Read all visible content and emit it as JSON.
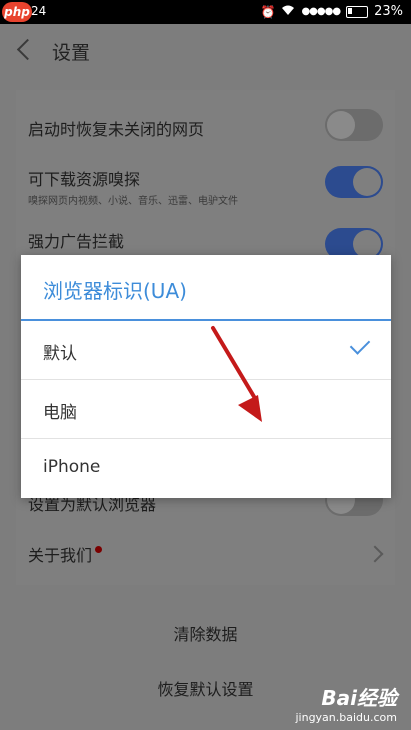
{
  "status_bar": {
    "logo": "php",
    "time": "24",
    "battery": "23%"
  },
  "header": {
    "title": "设置"
  },
  "settings": [
    {
      "title": "启动时恢复未关闭的网页",
      "sub": "",
      "toggle": "off"
    },
    {
      "title": "可下载资源嗅探",
      "sub": "嗅探网页内视频、小说、音乐、迅雷、电驴文件",
      "toggle": "on"
    },
    {
      "title": "强力广告拦截",
      "sub": "",
      "toggle": "on"
    },
    {
      "title": "设置为默认浏览器",
      "sub": "",
      "toggle": "off"
    },
    {
      "title": "关于我们",
      "sub": "",
      "toggle": "none"
    }
  ],
  "bottom_buttons": {
    "clear": "清除数据",
    "reset": "恢复默认设置"
  },
  "dialog": {
    "title": "浏览器标识(UA)",
    "options": [
      {
        "label": "默认",
        "selected": true
      },
      {
        "label": "电脑",
        "selected": false
      },
      {
        "label": "iPhone",
        "selected": false
      }
    ]
  },
  "watermark": {
    "logo": "Bai经验",
    "url": "jingyan.baidu.com"
  }
}
